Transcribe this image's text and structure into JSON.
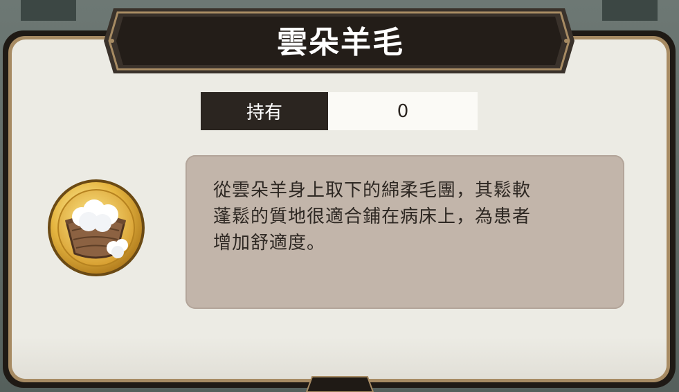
{
  "dialog": {
    "title": "雲朵羊毛",
    "owned_label": "持有",
    "owned_value": "0",
    "description": "從雲朵羊身上取下的綿柔毛團，其鬆軟\n蓬鬆的質地很適合鋪在病床上，為患者\n增加舒適度。",
    "item_icon": "wool-basket-icon"
  },
  "colors": {
    "frame_dark": "#1f1a15",
    "frame_gold": "#a78b63",
    "panel_bg": "#ecebe4",
    "desc_bg": "#c2b5aa",
    "coin_gold": "#d9a63a"
  }
}
